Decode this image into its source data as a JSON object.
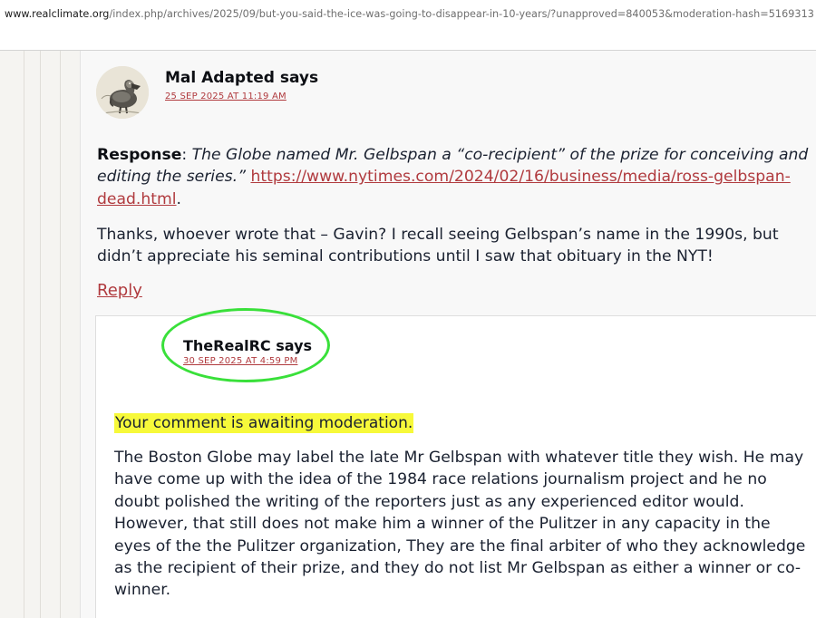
{
  "browser": {
    "url_host": "www.realclimate.org",
    "url_path": "/index.php/archives/2025/09/but-you-said-the-ice-was-going-to-disappear-in-10-years/?unapproved=840053&moderation-hash=5169313"
  },
  "comment": {
    "author": "Mal Adapted says",
    "date": "25 SEP 2025 AT 11:19 AM",
    "response_label": "Response",
    "response_text": "The Globe named Mr. Gelbspan a “co-recipient” of the prize for conceiving and editing the series.”",
    "response_link": "https://www.nytimes.com/2024/02/16/business/media/ross-gelbspan-dead.html",
    "body": "Thanks, whoever wrote that – Gavin? I recall seeing Gelbspan’s name in the 1990s, but didn’t appreciate his seminal contributions until I saw that obituary in the NYT!",
    "reply_label": "Reply"
  },
  "reply": {
    "author": "TheRealRC says",
    "date": "30 SEP 2025 AT 4:59 PM",
    "moderation_notice": "Your comment is awaiting moderation.",
    "body": "The Boston Globe may label the late Mr Gelbspan with whatever title they wish. He may have come up with the idea of the 1984 race relations journalism project and he no doubt polished the writing of the reporters just as any experienced editor would. However, that still does not make him a winner of the Pulitzer in any capacity in the eyes of the the Pulitzer organization, They are the final arbiter of who they acknowledge as the recipient of their prize, and they do not list Mr Gelbspan as either a winner or co-winner."
  },
  "colors": {
    "link": "#b03a3e",
    "highlight": "#f7f93a",
    "annotation_circle": "#39e03a"
  }
}
